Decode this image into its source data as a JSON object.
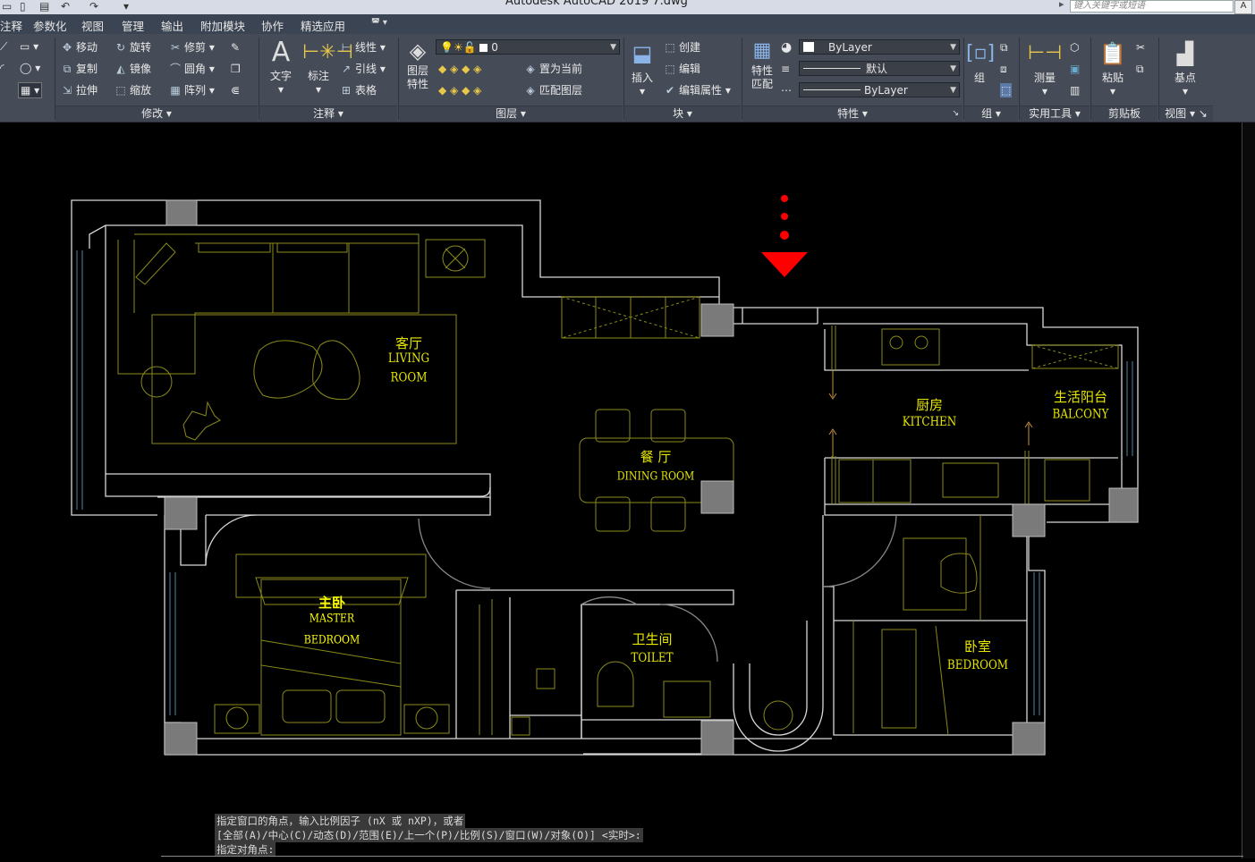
{
  "window": {
    "title": "Autodesk AutoCAD 2019      7.dwg",
    "search_placeholder": "键入关键字或短语"
  },
  "menubar": {
    "items": [
      "注释",
      "参数化",
      "视图",
      "管理",
      "输出",
      "附加模块",
      "协作",
      "精选应用"
    ]
  },
  "ribbon": {
    "modify": {
      "title": "修改",
      "items": [
        "移动",
        "旋转",
        "修剪",
        "复制",
        "镜像",
        "圆角",
        "拉伸",
        "缩放",
        "阵列"
      ]
    },
    "annotation": {
      "title": "注释",
      "text_label": "文字",
      "dim_label": "标注",
      "items": [
        "线性",
        "引线",
        "表格"
      ]
    },
    "layers": {
      "title": "图层",
      "props_label": "图层\n特性",
      "layer_combo": "0",
      "items": [
        "置为当前",
        "匹配图层"
      ]
    },
    "block": {
      "title": "块",
      "insert_label": "插入",
      "items": [
        "创建",
        "编辑",
        "编辑属性"
      ]
    },
    "properties": {
      "title": "特性",
      "match_label": "特性\n匹配",
      "color": "ByLayer",
      "lineweight": "默认",
      "linetype": "ByLayer"
    },
    "groups": {
      "title": "组",
      "group_label": "组"
    },
    "utilities": {
      "title": "实用工具",
      "measure_label": "测量"
    },
    "clipboard": {
      "title": "剪贴板",
      "paste_label": "粘贴"
    },
    "view": {
      "title": "视图",
      "base_label": "基点"
    }
  },
  "drawing": {
    "rooms": [
      {
        "cn": "客厅",
        "en": "LIVING ROOM"
      },
      {
        "cn": "餐 厅",
        "en": "DINING ROOM"
      },
      {
        "cn": "厨房",
        "en": "KITCHEN"
      },
      {
        "cn": "生活阳台",
        "en": "BALCONY"
      },
      {
        "cn": "主卧",
        "en": "MASTER BEDROOM"
      },
      {
        "cn": "卫生间",
        "en": "TOILET"
      },
      {
        "cn": "卧室",
        "en": "BEDROOM"
      }
    ]
  },
  "command": {
    "line1": "指定窗口的角点，输入比例因子 (nX 或 nXP)，或者",
    "line2": "[全部(A)/中心(C)/动态(D)/范围(E)/上一个(P)/比例(S)/窗口(W)/对象(O)] <实时>:",
    "line3": "指定对角点:"
  },
  "colors": {
    "canvas": "#000000",
    "wall": "#d8d8d8",
    "furniture": "#8a8a1a",
    "label_cn": "#e6e600",
    "column": "#7a7a7a",
    "marker": "#ff0000"
  }
}
